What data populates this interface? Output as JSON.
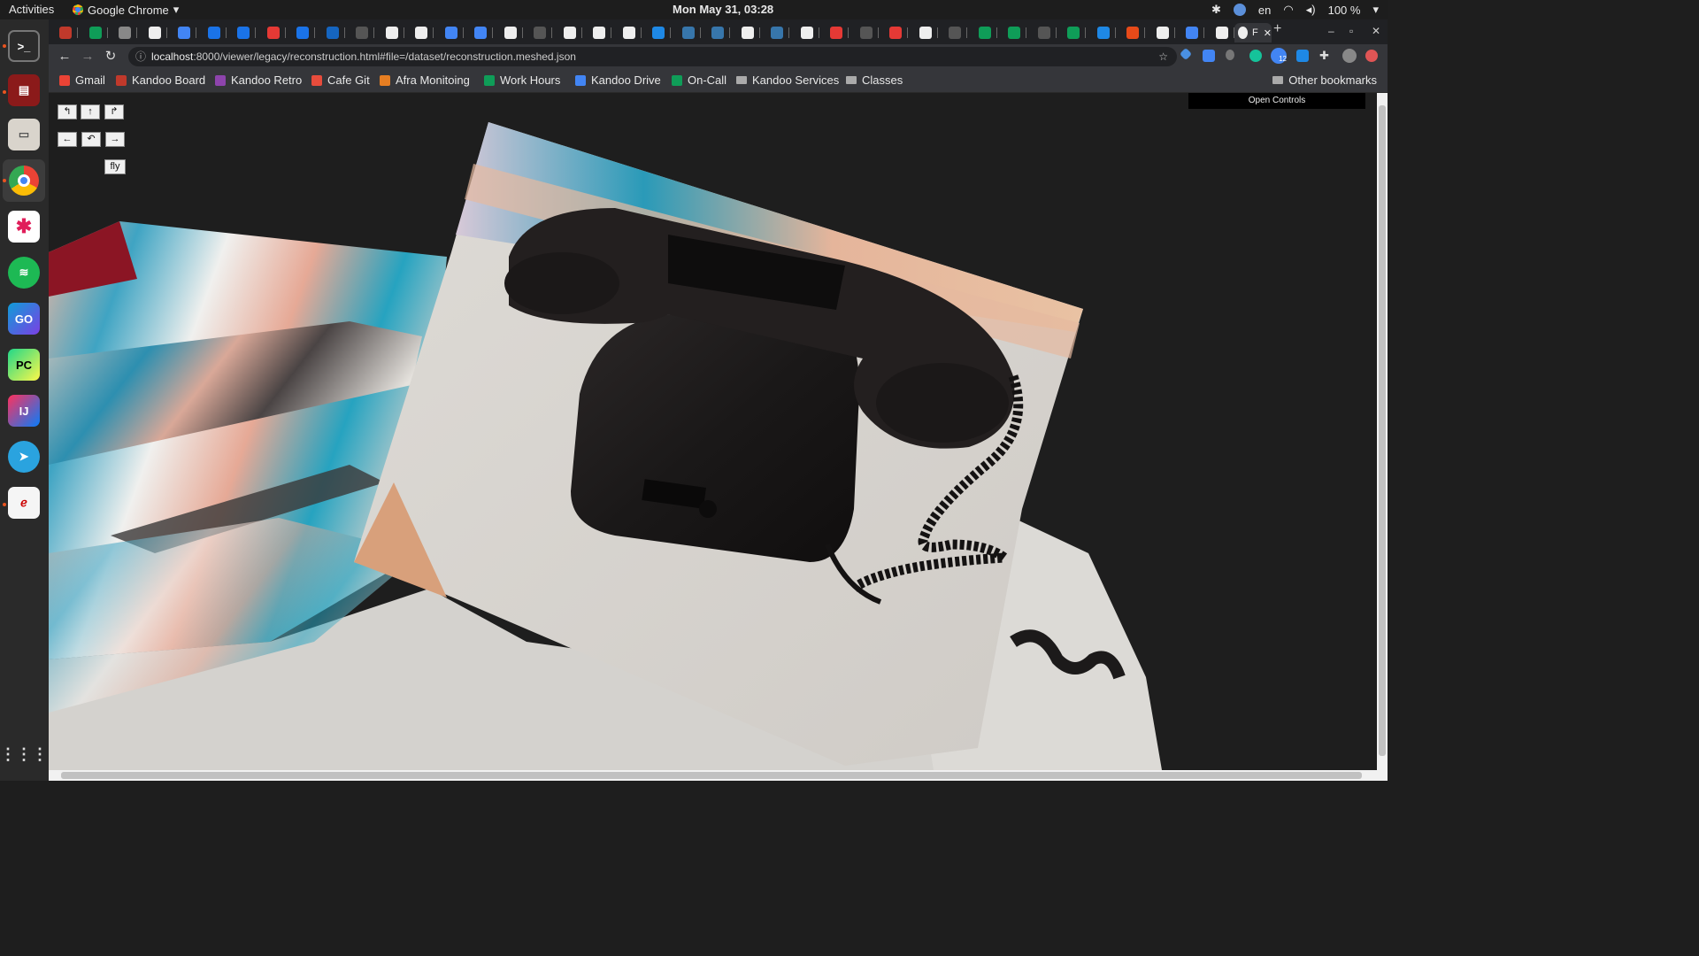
{
  "system_bar": {
    "activities": "Activities",
    "app_name": "Google Chrome",
    "clock": "Mon May 31, 03:28",
    "language": "en",
    "battery": "100 %"
  },
  "dock": {
    "items": [
      "terminal-icon",
      "app-launcher-icon",
      "files-icon",
      "chrome-icon",
      "slack-icon",
      "spotify-icon",
      "goland-icon",
      "pycharm-icon",
      "intellij-icon",
      "telegram-icon",
      "pdf-viewer-icon"
    ],
    "goland_label": "GO",
    "pycharm_label": "PC",
    "intellij_label": "IJ"
  },
  "tabs": {
    "active_label": "F",
    "new_tab": "+"
  },
  "toolbar": {
    "url_host": "localhost",
    "url_rest": ":8000/viewer/legacy/reconstruction.html#file=/dataset/reconstruction.meshed.json",
    "extension_badge": "12"
  },
  "bookmarks": [
    {
      "label": "Gmail",
      "color": "#ea4335"
    },
    {
      "label": "Kandoo Board",
      "color": "#c0392b"
    },
    {
      "label": "Kandoo Retro",
      "color": "#8e44ad"
    },
    {
      "label": "Cafe Git",
      "color": "#e74c3c"
    },
    {
      "label": "Afra Monitoing",
      "color": "#e67e22"
    },
    {
      "label": "Work Hours",
      "color": "#0f9d58"
    },
    {
      "label": "Kandoo Drive",
      "color": "#4285f4"
    },
    {
      "label": "On-Call",
      "color": "#0f9d58"
    },
    {
      "label": "Kandoo Services",
      "color": "folder"
    },
    {
      "label": "Classes",
      "color": "folder"
    }
  ],
  "other_bookmarks": "Other bookmarks",
  "viewer": {
    "rotate_left": "↰",
    "up": "↑",
    "rotate_right": "↱",
    "left": "←",
    "reset": "↶",
    "right": "→",
    "fly": "fly",
    "open_controls": "Open Controls"
  },
  "colors": {
    "background": "#1e1e1e",
    "table_surface": "#dcdcd8",
    "phone_black": "#1c1a1a"
  }
}
